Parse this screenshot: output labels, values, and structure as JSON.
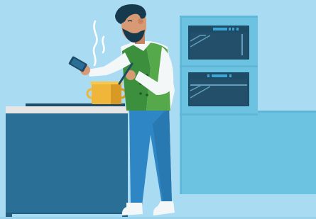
{
  "scene": {
    "subject": "man-cooking-in-kitchen",
    "colors": {
      "wall": "#a9dcf3",
      "cabinet_light": "#6cc3e1",
      "cabinet_light_edge": "#5fb6d6",
      "counter_blue": "#2a6f96",
      "counter_top": "#e6e6e6",
      "oven_dark": "#1e4b66",
      "oven_display": "#3aa7d6",
      "vest_green": "#3c8f3c",
      "vest_green_light": "#56a94a",
      "shirt_white": "#f4f7f8",
      "pants_blue": "#2f86c4",
      "skin": "#d79a74",
      "hair": "#17394d",
      "pot_yellow": "#f0b63a",
      "pot_shadow": "#d89a24",
      "steam": "#ffffff"
    },
    "icons": {
      "phone": "phone-icon",
      "spoon": "spoon-icon",
      "steam": "steam-icon"
    }
  }
}
